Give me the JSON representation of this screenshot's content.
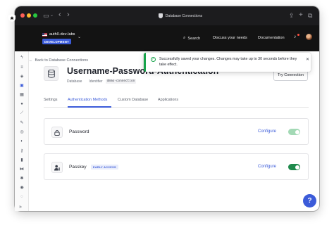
{
  "browser": {
    "address": "Database Connections"
  },
  "topbar": {
    "tenant_name": "auth0-dev-labs",
    "environment_badge": "DEVELOPMENT",
    "search_label": "Search",
    "discuss_label": "Discuss your needs",
    "docs_label": "Documentation"
  },
  "sidebar": {
    "icons": [
      "lightning-icon",
      "layers-icon",
      "shield-icon",
      "lock-icon",
      "apps-icon",
      "user-icon",
      "code-icon",
      "pen-icon",
      "broadcast-icon",
      "branding-icon",
      "key-icon",
      "chart-icon",
      "extensions-icon",
      "settings-icon",
      "marketplace-icon",
      "help-icon"
    ]
  },
  "page": {
    "back_label": "Back to Database Connections",
    "title": "Username-Password-Authentication",
    "subtitle_type": "Database",
    "identifier_label": "Identifier",
    "identifier_value": "dmmo-connection",
    "try_button": "Try Connection"
  },
  "toast": {
    "message": "Successfully saved your changes. Changes may take up to 30 seconds before they take effect."
  },
  "tabs": [
    {
      "label": "Settings"
    },
    {
      "label": "Authentication Methods",
      "active": true
    },
    {
      "label": "Custom Database"
    },
    {
      "label": "Applications"
    }
  ],
  "methods": [
    {
      "name": "Password",
      "icon": "lock-icon",
      "configure": "Configure",
      "enabled": true,
      "toggle_color": "#a3d9b5"
    },
    {
      "name": "Passkey",
      "icon": "user-key-icon",
      "badge": "EARLY ACCESS",
      "configure": "Configure",
      "enabled": true,
      "toggle_color": "#1f8a4c"
    }
  ],
  "colors": {
    "accent": "#3b5bd9",
    "success": "#16a34a"
  },
  "help_button": "?"
}
